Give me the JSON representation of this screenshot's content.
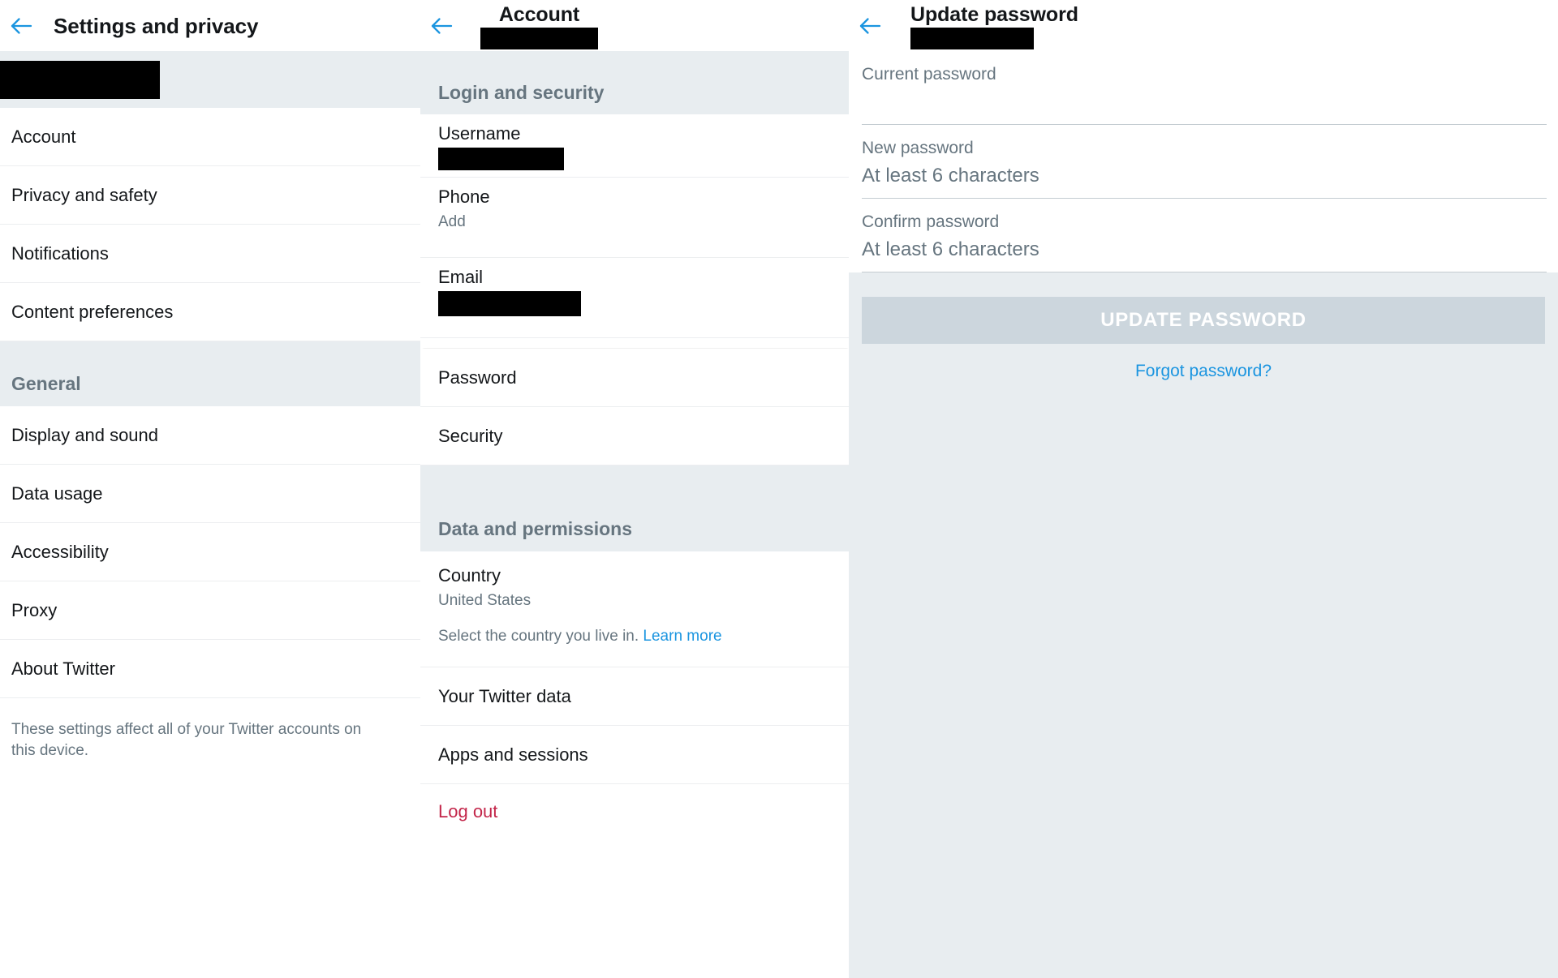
{
  "colors": {
    "accent": "#1b95e0",
    "section_bg": "#e8edf0",
    "section_text": "#66757f",
    "text_primary": "#14171a",
    "danger": "#c3264a",
    "button_disabled": "#ccd6dd",
    "redaction": "#000000"
  },
  "panel_settings": {
    "appbar": {
      "back_icon": "back-arrow-icon",
      "title": "Settings and privacy"
    },
    "account_band": {
      "redacted": true
    },
    "items": [
      {
        "label": "Account"
      },
      {
        "label": "Privacy and safety"
      },
      {
        "label": "Notifications"
      },
      {
        "label": "Content preferences"
      }
    ],
    "general_header": "General",
    "general_items": [
      {
        "label": "Display and sound"
      },
      {
        "label": "Data usage"
      },
      {
        "label": "Accessibility"
      },
      {
        "label": "Proxy"
      },
      {
        "label": "About Twitter"
      }
    ],
    "footer_note": "These settings affect all of your Twitter accounts on this device."
  },
  "panel_account": {
    "appbar": {
      "back_icon": "back-arrow-icon",
      "title": "Account",
      "subtitle_redacted": true
    },
    "login_security_header": "Login and security",
    "username_row": {
      "label": "Username",
      "value_redacted": true
    },
    "phone_row": {
      "label": "Phone",
      "value": "Add"
    },
    "email_row": {
      "label": "Email",
      "value_redacted": true
    },
    "password_row": {
      "label": "Password"
    },
    "security_row": {
      "label": "Security"
    },
    "data_permissions_header": "Data and permissions",
    "country_row": {
      "label": "Country",
      "value": "United States",
      "help_text": "Select the country you live in. ",
      "help_link": "Learn more"
    },
    "twitter_data_row": {
      "label": "Your Twitter data"
    },
    "apps_sessions_row": {
      "label": "Apps and sessions"
    },
    "logout_row": {
      "label": "Log out"
    }
  },
  "panel_update": {
    "appbar": {
      "back_icon": "back-arrow-icon",
      "title": "Update password",
      "subtitle_redacted": true
    },
    "fields": [
      {
        "label": "Current password",
        "value": ""
      },
      {
        "label": "New password",
        "value": "At least 6 characters"
      },
      {
        "label": "Confirm password",
        "value": "At least 6 characters"
      }
    ],
    "submit_button": "UPDATE PASSWORD",
    "forgot_link": "Forgot password?"
  }
}
